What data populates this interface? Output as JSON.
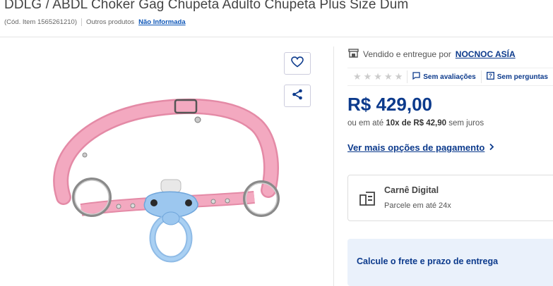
{
  "product": {
    "title": "DDLG / ABDL Choker Gag Chupeta Adulto Chupeta Plus Size Dum",
    "code": "(Cód. Item 1565261210)",
    "others_label": "Outros produtos",
    "others_link": "Não Informada"
  },
  "actions": {
    "favorite_icon": "heart-icon",
    "share_icon": "share-icon"
  },
  "seller": {
    "prefix": "Vendido e entregue por",
    "name": "NOCNOC ASÍA"
  },
  "reviews": {
    "stars": "★★★★★",
    "rating_filled": 0,
    "no_reviews": "Sem avaliações",
    "no_questions": "Sem perguntas"
  },
  "pricing": {
    "price": "R$ 429,00",
    "install_prefix": "ou em até",
    "install_count": "10x de R$ 42,90",
    "install_suffix": "sem juros",
    "more_options": "Ver mais opções de pagamento"
  },
  "carne": {
    "title": "Carnê Digital",
    "subtitle": "Parcele em até 24x"
  },
  "shipping": {
    "label": "Calcule o frete e prazo de entrega"
  },
  "colors": {
    "primary": "#0c3a8c",
    "link": "#0c55b7",
    "strap": "#f3a9c0",
    "pacifier": "#9cc7ef"
  }
}
